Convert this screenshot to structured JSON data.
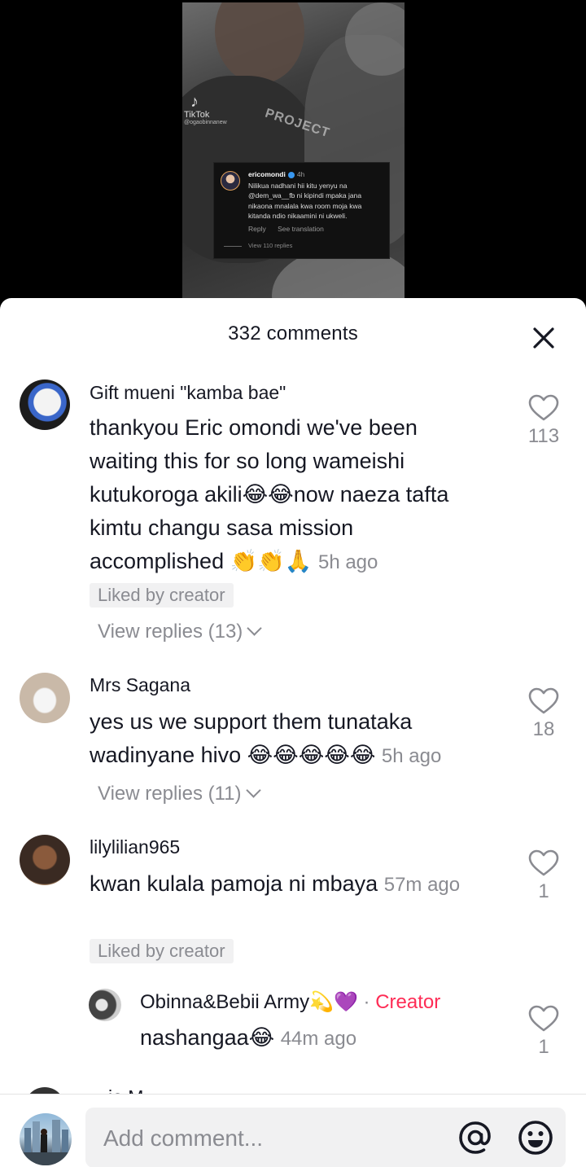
{
  "video": {
    "watermark": {
      "logo": "♪",
      "brand": "TikTok",
      "handle": "@ogaobinnanew"
    },
    "shirt_text": "PROJECT",
    "screenshot_comment": {
      "username": "ericomondi",
      "time": "4h",
      "text": "Nilikua nadhani hii kitu yenyu na @dem_wa__fb ni kipindi mpaka jana nikaona mnalala kwa room moja kwa kitanda ndio nikaamini ni ukweli.",
      "reply_label": "Reply",
      "translate_label": "See translation",
      "view_replies_label": "View 110 replies"
    }
  },
  "sheet": {
    "title": "332 comments",
    "close_icon": "close-icon"
  },
  "comments": [
    {
      "username": "Gift mueni \"kamba bae\"",
      "text": "thankyou Eric omondi we've been waiting this for so long wameishi kutukoroga akili😂😂now naeza tafta kimtu changu sasa mission accomplished 👏👏🙏",
      "time": "5h ago",
      "liked_by_creator": "Liked by creator",
      "view_replies": "View replies (13)",
      "likes": "113"
    },
    {
      "username": "Mrs Sagana",
      "text": "yes us we support them tunataka wadinyane hivo 😂😂😂😂😂",
      "time": "5h ago",
      "view_replies": "View replies (11)",
      "likes": "18"
    },
    {
      "username": "lilylilian965",
      "text": "kwan kulala pamoja ni mbaya",
      "time": "57m ago",
      "liked_by_creator": "Liked by creator",
      "likes": "1"
    }
  ],
  "reply": {
    "username": "Obinna&Bebii Army💫💜",
    "separator": "·",
    "creator_tag": "Creator",
    "text": "nashangaa😂",
    "time": "44m ago",
    "likes": "1"
  },
  "partial_next": {
    "username": "…ie M…"
  },
  "bottom": {
    "placeholder": "Add comment...",
    "mention_icon": "at-icon",
    "emoji_icon": "emoji-icon"
  },
  "colors": {
    "accent": "#fe2c55",
    "secondary_text": "#8a8b91",
    "primary_text": "#161823"
  }
}
